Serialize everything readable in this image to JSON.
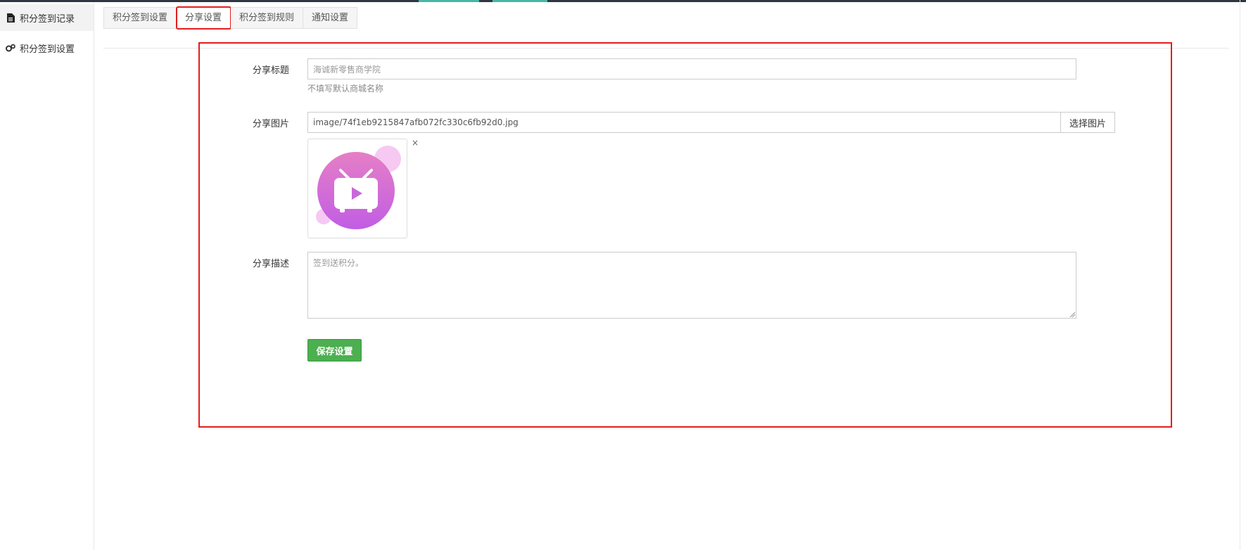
{
  "sidebar": {
    "items": [
      {
        "label": "积分签到记录",
        "icon": "document-icon",
        "active": true
      },
      {
        "label": "积分签到设置",
        "icon": "gears-icon",
        "active": false
      }
    ]
  },
  "tabs": [
    {
      "label": "积分签到设置",
      "active": false
    },
    {
      "label": "分享设置",
      "active": true
    },
    {
      "label": "积分签到规则",
      "active": false
    },
    {
      "label": "通知设置",
      "active": false
    }
  ],
  "form": {
    "share_title": {
      "label": "分享标题",
      "placeholder": "海诚新零售商学院",
      "help": "不填写默认商城名称"
    },
    "share_image": {
      "label": "分享图片",
      "value": "image/74f1eb9215847afb072fc330c6fb92d0.jpg",
      "button_label": "选择图片",
      "remove_label": "×"
    },
    "share_desc": {
      "label": "分享描述",
      "placeholder": "签到送积分。"
    },
    "save_label": "保存设置"
  },
  "colors": {
    "accent_red": "#e41d1d",
    "save_green": "#4caf50",
    "topbar": "#2e3641"
  }
}
